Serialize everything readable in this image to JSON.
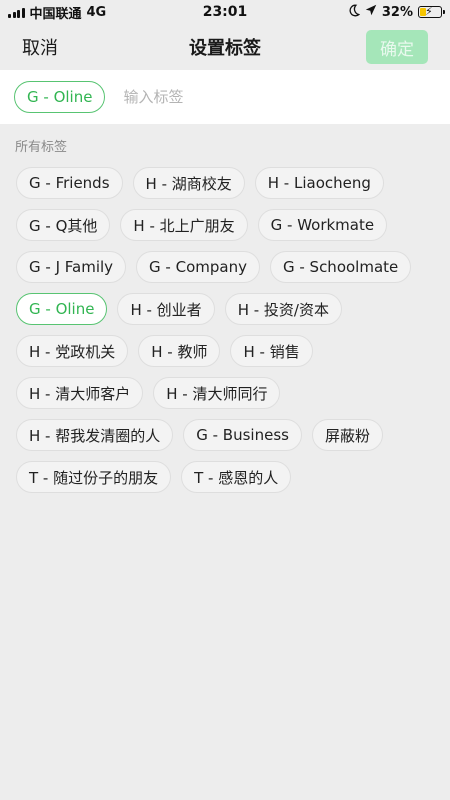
{
  "status_bar": {
    "carrier": "中国联通",
    "network": "4G",
    "time": "23:01",
    "battery_percent": "32%",
    "battery_level": 0.32,
    "icons": [
      "signal-icon",
      "moon-icon",
      "location-arrow-icon",
      "battery-charging-icon"
    ]
  },
  "nav": {
    "cancel_label": "取消",
    "title": "设置标签",
    "confirm_label": "确定"
  },
  "input": {
    "selected_tags": [
      "G - Oline"
    ],
    "placeholder": "输入标签",
    "value": ""
  },
  "all_tags": {
    "label": "所有标签",
    "tags": [
      {
        "label": "G - Friends",
        "selected": false
      },
      {
        "label": "H - 湖商校友",
        "selected": false
      },
      {
        "label": "H - Liaocheng",
        "selected": false
      },
      {
        "label": "G - Q其他",
        "selected": false
      },
      {
        "label": "H - 北上广朋友",
        "selected": false
      },
      {
        "label": "G - Workmate",
        "selected": false
      },
      {
        "label": "G - J Family",
        "selected": false
      },
      {
        "label": "G - Company",
        "selected": false
      },
      {
        "label": "G - Schoolmate",
        "selected": false
      },
      {
        "label": "G - Oline",
        "selected": true
      },
      {
        "label": "H - 创业者",
        "selected": false
      },
      {
        "label": "H - 投资/资本",
        "selected": false
      },
      {
        "label": "H - 党政机关",
        "selected": false
      },
      {
        "label": "H - 教师",
        "selected": false
      },
      {
        "label": "H - 销售",
        "selected": false
      },
      {
        "label": "H - 清大师客户",
        "selected": false
      },
      {
        "label": "H - 清大师同行",
        "selected": false
      },
      {
        "label": "H - 帮我发清圈的人",
        "selected": false
      },
      {
        "label": "G - Business",
        "selected": false
      },
      {
        "label": "屏蔽粉",
        "selected": false
      },
      {
        "label": "T - 随过份子的朋友",
        "selected": false
      },
      {
        "label": "T - 感恩的人",
        "selected": false
      }
    ]
  },
  "colors": {
    "accent_green": "#32b552",
    "confirm_disabled_bg": "#a5e6b9",
    "background": "#ededed"
  }
}
